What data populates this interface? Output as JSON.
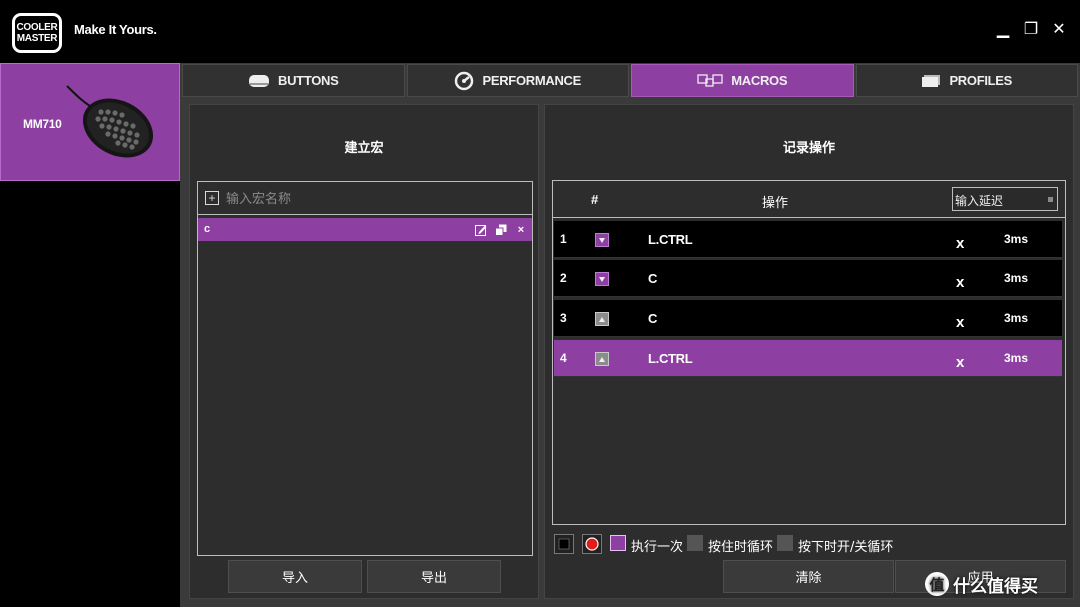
{
  "app": {
    "logo_text_1": "COOLER",
    "logo_text_2": "MASTER",
    "tagline": "Make It Yours."
  },
  "window_controls": {
    "minimize": "▁",
    "maximize": "❐",
    "close": "✕"
  },
  "device": {
    "name": "MM710"
  },
  "tabs": [
    {
      "label": "BUTTONS",
      "icon": "mouse-icon",
      "active": false
    },
    {
      "label": "PERFORMANCE",
      "icon": "gauge-icon",
      "active": false
    },
    {
      "label": "MACROS",
      "icon": "macro-keys-icon",
      "active": true
    },
    {
      "label": "PROFILES",
      "icon": "profiles-icon",
      "active": false
    }
  ],
  "left_panel": {
    "title": "建立宏",
    "input_placeholder": "输入宏名称",
    "macros": [
      {
        "name": "c",
        "selected": true
      }
    ],
    "import_label": "导入",
    "export_label": "导出"
  },
  "right_panel": {
    "title": "记录操作",
    "columns": {
      "hash": "#",
      "operation": "操作",
      "delay_input": "输入延迟"
    },
    "rows": [
      {
        "num": "1",
        "action": "press",
        "key": "L.CTRL",
        "delete": "x",
        "delay": "3ms",
        "selected": false
      },
      {
        "num": "2",
        "action": "press",
        "key": "C",
        "delete": "x",
        "delay": "3ms",
        "selected": false
      },
      {
        "num": "3",
        "action": "release",
        "key": "C",
        "delete": "x",
        "delay": "3ms",
        "selected": false
      },
      {
        "num": "4",
        "action": "release",
        "key": "L.CTRL",
        "delete": "x",
        "delay": "3ms",
        "selected": true
      }
    ],
    "options": [
      {
        "label": "执行一次",
        "checked": true
      },
      {
        "label": "按住时循环",
        "checked": false
      },
      {
        "label": "按下时开/关循环",
        "checked": false
      }
    ],
    "clear_label": "清除",
    "apply_label": "应用"
  },
  "watermark": {
    "badge": "值",
    "text": "什么值得买"
  },
  "colors": {
    "accent": "#8e3fa2",
    "background": "#000000",
    "panel": "#2d2d2d",
    "record_red": "#e31b1b"
  }
}
